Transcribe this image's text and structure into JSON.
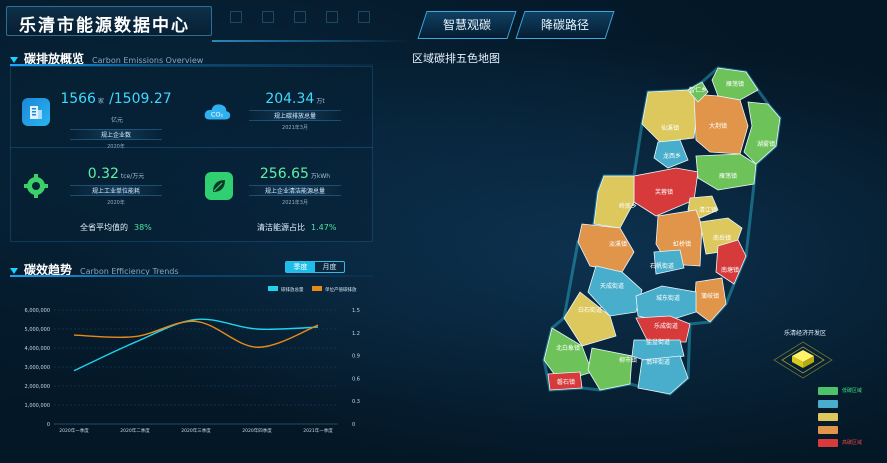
{
  "header": {
    "title": "乐清市能源数据中心",
    "tabs": [
      {
        "label": "智慧观碳",
        "active": true
      },
      {
        "label": "降碳路径",
        "active": false
      }
    ]
  },
  "overview": {
    "title": "碳排放概览",
    "title_en": "Carbon Emissions Overview",
    "kpis": [
      {
        "value": "1566",
        "unit": "家",
        "value2": "/1509.27",
        "unit2": "亿元",
        "label": "规上企业数",
        "date": "2020年",
        "icon": "building-icon"
      },
      {
        "value": "204.34",
        "unit": "万t",
        "label": "规上碳排放总量",
        "date": "2021年3月",
        "icon": "co2-cloud-icon"
      },
      {
        "value": "0.32",
        "unit": "tce/万元",
        "label": "规上工业单位能耗",
        "date": "2020年",
        "icon": "gear-icon"
      },
      {
        "value": "256.65",
        "unit": "万kWh",
        "label": "规上企业清洁能源总量",
        "date": "2021年3月",
        "icon": "leaf-icon"
      }
    ],
    "ratios": [
      {
        "label": "全省平均值的",
        "value": "38%"
      },
      {
        "label": "清洁能源占比",
        "value": "1.47%"
      }
    ]
  },
  "trend": {
    "title": "碳效趋势",
    "title_en": "Carbon Efficiency Trends",
    "toggle": {
      "options": [
        "季度",
        "月度"
      ],
      "active": 0
    }
  },
  "chart_data": {
    "type": "line",
    "categories": [
      "2020年一季度",
      "2020年二季度",
      "2020年三季度",
      "2020年四季度",
      "2021年一季度"
    ],
    "series": [
      {
        "name": "碳排放总量",
        "axis": "left",
        "color": "#1fd3ee",
        "values": [
          2800000,
          4300000,
          5500000,
          5000000,
          5100000
        ]
      },
      {
        "name": "单位产值碳排放",
        "axis": "right",
        "color": "#e88a16",
        "values": [
          1.17,
          1.15,
          1.35,
          1.01,
          1.3
        ]
      }
    ],
    "yleft": {
      "ticks": [
        0,
        1000000,
        2000000,
        3000000,
        4000000,
        5000000,
        6000000
      ],
      "labels": [
        "0",
        "1,000,000",
        "2,000,000",
        "3,000,000",
        "4,000,000",
        "5,000,000",
        "6,000,000"
      ],
      "ylim": [
        0,
        6000000
      ]
    },
    "yright": {
      "ticks": [
        0,
        0.3,
        0.6,
        0.9,
        1.2,
        1.5
      ],
      "labels": [
        "0",
        "0.3",
        "0.6",
        "0.9",
        "1.2",
        "1.5"
      ],
      "ylim": [
        0,
        1.5
      ]
    },
    "legend_placement": "top-right"
  },
  "map": {
    "title": "区域碳排五色地图",
    "regions": [
      {
        "name": "雁荡镇",
        "color": "#6dc35a"
      },
      {
        "name": "仙溪镇",
        "color": "#dcc85c"
      },
      {
        "name": "大荆镇",
        "color": "#e0954a"
      },
      {
        "name": "湖雾镇",
        "color": "#6dc35a"
      },
      {
        "name": "智仁乡",
        "color": "#6dc35a"
      },
      {
        "name": "龙西乡",
        "color": "#48aecb"
      },
      {
        "name": "芙蓉镇",
        "color": "#d63a3a"
      },
      {
        "name": "雁荡镇",
        "color": "#6dc35a"
      },
      {
        "name": "岭底乡",
        "color": "#dcc85c"
      },
      {
        "name": "清江镇",
        "color": "#dcc85c"
      },
      {
        "name": "淡溪镇",
        "color": "#e0954a"
      },
      {
        "name": "虹桥镇",
        "color": "#e0954a"
      },
      {
        "name": "南岳镇",
        "color": "#dcc85c"
      },
      {
        "name": "石帆街道",
        "color": "#48aecb"
      },
      {
        "name": "南塘镇",
        "color": "#d63a3a"
      },
      {
        "name": "天成街道",
        "color": "#48aecb"
      },
      {
        "name": "蒲岐镇",
        "color": "#e0954a"
      },
      {
        "name": "城东街道",
        "color": "#48aecb"
      },
      {
        "name": "白石街道",
        "color": "#dcc85c"
      },
      {
        "name": "乐成街道",
        "color": "#d63a3a"
      },
      {
        "name": "北白象镇",
        "color": "#6dc35a"
      },
      {
        "name": "盐盆街道",
        "color": "#48aecb"
      },
      {
        "name": "柳市镇",
        "color": "#6dc35a"
      },
      {
        "name": "翁垟街道",
        "color": "#48aecb"
      },
      {
        "name": "磐石镇",
        "color": "#d63a3a"
      }
    ]
  },
  "zone": {
    "label": "乐清经济开发区"
  },
  "legend": [
    {
      "label": "低碳区域",
      "color": "#4cc36a",
      "text_color": "#3ee07c"
    },
    {
      "label": "",
      "color": "#48aecb",
      "text_color": "#48aecb"
    },
    {
      "label": "",
      "color": "#dcc85c",
      "text_color": "#dcc85c"
    },
    {
      "label": "",
      "color": "#e0954a",
      "text_color": "#e0954a"
    },
    {
      "label": "高碳区域",
      "color": "#d63a3a",
      "text_color": "#e84848"
    }
  ]
}
